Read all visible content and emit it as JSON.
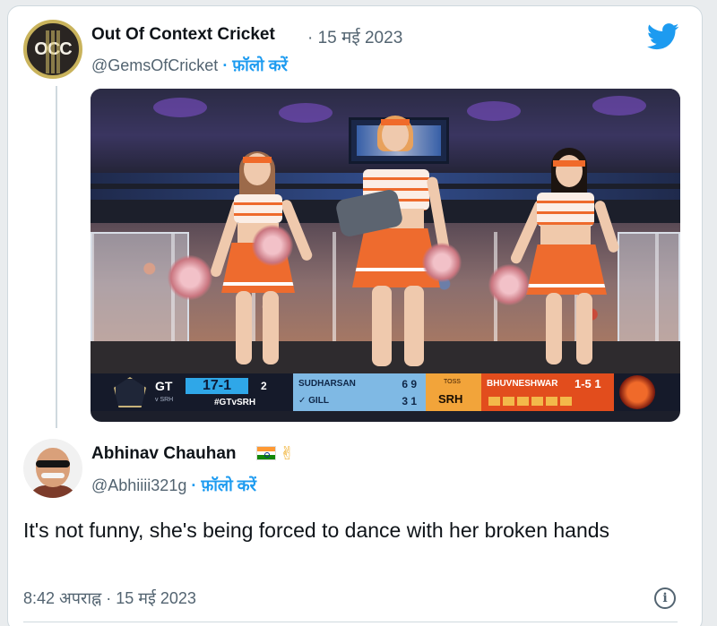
{
  "quoted_tweet": {
    "author_name": "Out Of Context Cricket",
    "date": "· 15 मई 2023",
    "handle": "@GemsOfCricket",
    "follow_label": "· फ़ॉलो करें",
    "avatar_text": "OCC"
  },
  "media": {
    "scorebar": {
      "team": "GT",
      "team_sub": "v SRH",
      "score": "17-1",
      "overs": "2",
      "hashtag": "#GTvSRH",
      "batters": [
        {
          "name": "SUDHARSAN",
          "runs": "6 9"
        },
        {
          "name": "✓ GILL",
          "runs": "3 1"
        }
      ],
      "toss_label": "TOSS",
      "toss_team": "SRH",
      "bowler": "BHUVNESHWAR",
      "bowler_figures": "1-5 1"
    }
  },
  "reply": {
    "author_name": "Abhinav Chauhan",
    "handle": "@Abhiiii321g",
    "follow_label": "· फ़ॉलो करें",
    "text": "It's not funny, she's being forced to dance with her broken hands",
    "timestamp": "8:42 अपराह्न · 15 मई 2023",
    "info_glyph": "i"
  },
  "icons": {
    "brand": "twitter-bird-icon",
    "flag": "india-flag-icon",
    "hand": "fingers-crossed-icon",
    "info": "info-icon"
  },
  "colors": {
    "link": "#1d9bf0",
    "muted": "#536471",
    "text": "#0f1419",
    "border": "#cfd9de"
  }
}
